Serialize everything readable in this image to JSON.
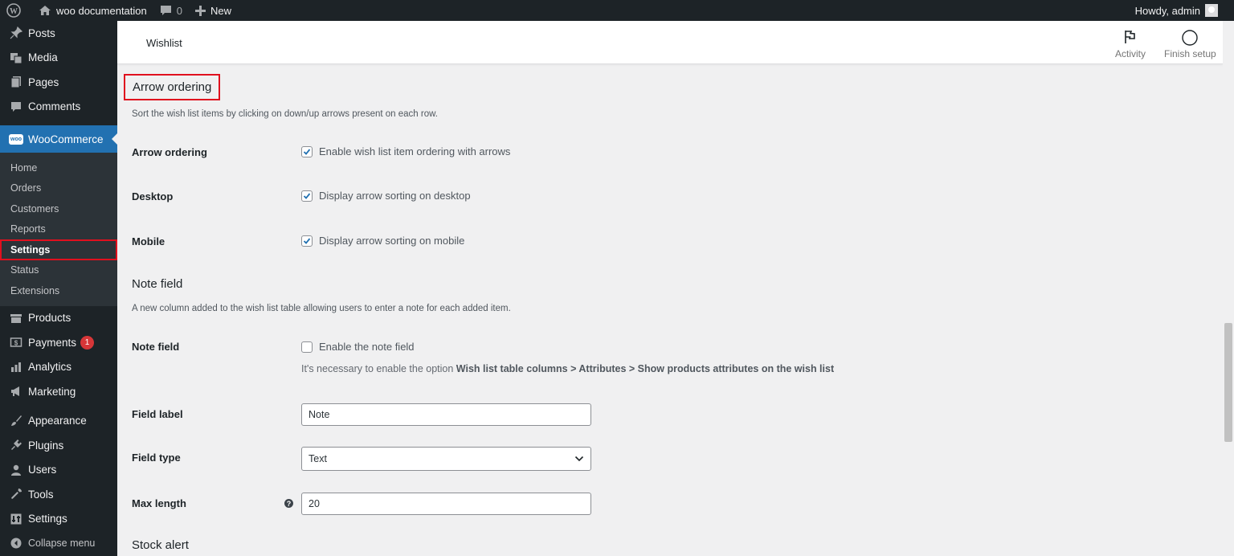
{
  "adminbar": {
    "site_name": "woo documentation",
    "comments_count": "0",
    "new_label": "New",
    "howdy": "Howdy, admin"
  },
  "sidebar": {
    "top_items": [
      {
        "label": "Posts",
        "icon": "pin-icon"
      },
      {
        "label": "Media",
        "icon": "media-icon"
      },
      {
        "label": "Pages",
        "icon": "pages-icon"
      },
      {
        "label": "Comments",
        "icon": "comment-icon"
      }
    ],
    "woocommerce": {
      "label": "WooCommerce",
      "icon_text": "woo"
    },
    "submenu": [
      "Home",
      "Orders",
      "Customers",
      "Reports",
      "Settings",
      "Status",
      "Extensions"
    ],
    "bottom_items": [
      {
        "label": "Products"
      },
      {
        "label": "Payments",
        "badge": "1"
      },
      {
        "label": "Analytics"
      },
      {
        "label": "Marketing"
      },
      {
        "label": "Appearance"
      },
      {
        "label": "Plugins"
      },
      {
        "label": "Users"
      },
      {
        "label": "Tools"
      },
      {
        "label": "Settings"
      },
      {
        "label": "Collapse menu"
      }
    ]
  },
  "header": {
    "title": "Wishlist",
    "activity": "Activity",
    "finish_setup": "Finish setup"
  },
  "content": {
    "arrow_section": {
      "title": "Arrow ordering",
      "desc": "Sort the wish list items by clicking on down/up arrows present on each row.",
      "rows": [
        {
          "label": "Arrow ordering",
          "text": "Enable wish list item ordering with arrows",
          "checked": true
        },
        {
          "label": "Desktop",
          "text": "Display arrow sorting on desktop",
          "checked": true
        },
        {
          "label": "Mobile",
          "text": "Display arrow sorting on mobile",
          "checked": true
        }
      ]
    },
    "note_section": {
      "title": "Note field",
      "desc": "A new column added to the wish list table allowing users to enter a note for each added item.",
      "note_label": "Note field",
      "note_text": "Enable the note field",
      "note_checked": false,
      "help_prefix": "It's necessary to enable the option ",
      "help_bold": "Wish list table columns > Attributes > Show products attributes on the wish list",
      "field_label_label": "Field label",
      "field_label_value": "Note",
      "field_type_label": "Field type",
      "field_type_value": "Text",
      "max_length_label": "Max length",
      "max_length_value": "20"
    },
    "stock_section": {
      "title": "Stock alert"
    }
  },
  "colors": {
    "accent": "#2271b1",
    "highlight_border": "#e0101e",
    "sidebar_bg": "#1d2327"
  }
}
